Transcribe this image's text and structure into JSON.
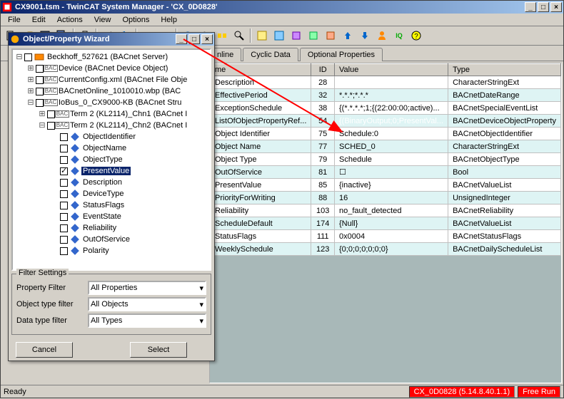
{
  "titlebar": {
    "text": "CX9001.tsm - TwinCAT System Manager - 'CX_0D0828'"
  },
  "menu": {
    "file": "File",
    "edit": "Edit",
    "actions": "Actions",
    "view": "View",
    "options": "Options",
    "help": "Help"
  },
  "wizard": {
    "title": "Object/Property Wizard",
    "filter_settings_label": "Filter Settings",
    "property_filter_label": "Property Filter",
    "object_filter_label": "Object type filter",
    "data_filter_label": "Data type filter",
    "property_filter_value": "All Properties",
    "object_filter_value": "All Objects",
    "data_filter_value": "All Types",
    "cancel_label": "Cancel",
    "select_label": "Select"
  },
  "tree": {
    "root": "Beckhoff_527621 (BACnet Server)",
    "n1": "Device (BACnet Device Object)",
    "n2": "CurrentConfig.xml (BACnet File Obje",
    "n3": "BACnetOnline_1010010.wbp (BAC",
    "n4": "IoBus_0_CX9000-KB (BACnet Stru",
    "n5": "Term 2 (KL2114)_Chn1 (BACnet I",
    "n6": "Term 2 (KL2114)_Chn2 (BACnet I",
    "p_objectidentifier": "ObjectIdentifier",
    "p_objectname": "ObjectName",
    "p_objecttype": "ObjectType",
    "p_presentvalue": "PresentValue",
    "p_description": "Description",
    "p_devicetype": "DeviceType",
    "p_statusflags": "StatusFlags",
    "p_eventstate": "EventState",
    "p_reliability": "Reliability",
    "p_outofservice": "OutOfService",
    "p_polarity": "Polarity"
  },
  "tabs": {
    "t1": "nline",
    "t2": "Cyclic Data",
    "t3": "Optional Properties"
  },
  "grid": {
    "h_name": "me",
    "h_id": "ID",
    "h_value": "Value",
    "h_type": "Type",
    "rows": [
      {
        "name": "Description",
        "id": "28",
        "value": "",
        "type": "CharacterStringExt"
      },
      {
        "name": "EffectivePeriod",
        "id": "32",
        "value": "*.*.*;*.*.*",
        "type": "BACnetDateRange"
      },
      {
        "name": "ExceptionSchedule",
        "id": "38",
        "value": "{(*.*.*.*;1;{(22:00:00;active)...",
        "type": "BACnetSpecialEventList"
      },
      {
        "name": "ListOfObjectPropertyRef...",
        "id": "54",
        "value": "{(BinaryOutput;0;PresentVal...",
        "type": "BACnetDeviceObjectProperty",
        "sel": true
      },
      {
        "name": "Object Identifier",
        "id": "75",
        "value": "Schedule:0",
        "type": "BACnetObjectIdentifier"
      },
      {
        "name": "Object Name",
        "id": "77",
        "value": "SCHED_0",
        "type": "CharacterStringExt"
      },
      {
        "name": "Object Type",
        "id": "79",
        "value": "Schedule",
        "type": "BACnetObjectType"
      },
      {
        "name": "OutOfService",
        "id": "81",
        "value": "☐",
        "type": "Bool"
      },
      {
        "name": "PresentValue",
        "id": "85",
        "value": "{inactive}",
        "type": "BACnetValueList"
      },
      {
        "name": "PriorityForWriting",
        "id": "88",
        "value": "16",
        "type": "UnsignedInteger"
      },
      {
        "name": "Reliability",
        "id": "103",
        "value": "no_fault_detected",
        "type": "BACnetReliability"
      },
      {
        "name": "ScheduleDefault",
        "id": "174",
        "value": "{Null}",
        "type": "BACnetValueList"
      },
      {
        "name": "StatusFlags",
        "id": "111",
        "value": "0x0004",
        "type": "BACnetStatusFlags"
      },
      {
        "name": "WeeklySchedule",
        "id": "123",
        "value": "{0;0;0;0;0;0;0}",
        "type": "BACnetDailyScheduleList"
      }
    ]
  },
  "status": {
    "ready": "Ready",
    "cx": "CX_0D0828 (5.14.8.40.1.1)",
    "freerun": "Free Run"
  }
}
